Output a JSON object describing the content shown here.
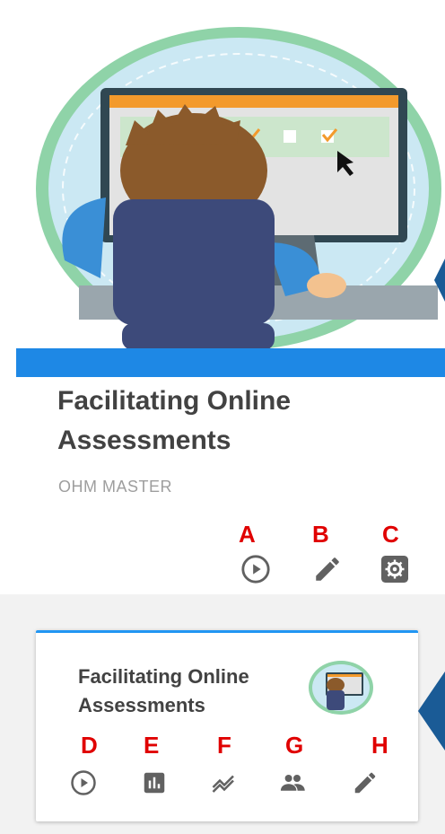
{
  "course_card": {
    "title": "Facilitating Online Assessments",
    "subtitle": "OHM MASTER",
    "icons": [
      {
        "label": "A",
        "icon": "play-circle-icon"
      },
      {
        "label": "B",
        "icon": "pencil-icon"
      },
      {
        "label": "C",
        "icon": "settings-icon"
      }
    ]
  },
  "small_card": {
    "title": "Facilitating Online Assessments",
    "icons": [
      {
        "label": "D",
        "icon": "play-circle-icon"
      },
      {
        "label": "E",
        "icon": "bar-chart-icon"
      },
      {
        "label": "F",
        "icon": "trend-icon"
      },
      {
        "label": "G",
        "icon": "people-icon"
      },
      {
        "label": "H",
        "icon": "pencil-icon"
      }
    ]
  },
  "colors": {
    "accent_blue": "#1e88e5",
    "label_red": "#e00000",
    "icon_gray": "#616161"
  }
}
